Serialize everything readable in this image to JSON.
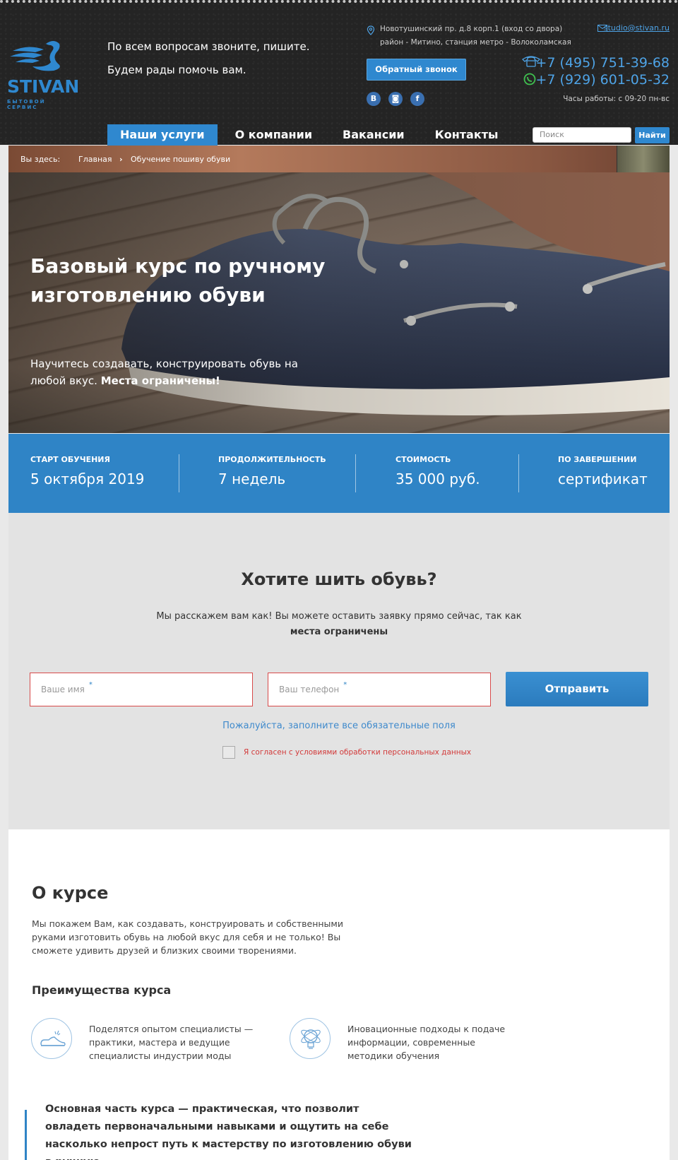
{
  "header": {
    "logo_text": "STIVAN",
    "logo_sub": "БЫТОВОЙ СЕРВИС",
    "tagline_line1": "По всем вопросам звоните, пишите.",
    "tagline_line2": "Будем рады помочь вам.",
    "address_line1": "Новотушинский пр. д.8 корп.1 (вход со двора)",
    "address_line2": "район - Митино, станция метро - Волоколамская",
    "callback_label": "Обратный звонок",
    "socials": [
      "В",
      "◙",
      "f"
    ],
    "email": "studio@stivan.ru",
    "phone1": "+7 (495) 751-39-68",
    "phone2": "+7 (929) 601-05-32",
    "hours": "Часы работы: с 09-20 пн-вс",
    "accent_color": "#2f88cf"
  },
  "nav": {
    "items": [
      {
        "label": "Наши услуги",
        "active": true
      },
      {
        "label": "О компании",
        "active": false
      },
      {
        "label": "Вакансии",
        "active": false
      },
      {
        "label": "Контакты",
        "active": false
      }
    ],
    "search_placeholder": "Поиск",
    "search_button": "Найти"
  },
  "breadcrumb": {
    "prefix": "Вы здесь:",
    "home": "Главная",
    "separator": "›",
    "current": "Обучение пошиву обуви"
  },
  "hero": {
    "title": "Базовый курс по ручному изготовлению обуви",
    "subtitle": "Научитесь создавать, конструировать обувь на любой вкус.",
    "subtitle_bold": "Места ограничены!"
  },
  "stats": [
    {
      "label": "СТАРТ ОБУЧЕНИЯ",
      "value": "5 октября 2019"
    },
    {
      "label": "ПРОДОЛЖИТЕЛЬНОСТЬ",
      "value": "7 недель"
    },
    {
      "label": "СТОИМОСТЬ",
      "value": "35 000 руб."
    },
    {
      "label": "ПО ЗАВЕРШЕНИИ",
      "value": "сертификат"
    }
  ],
  "form": {
    "title": "Хотите шить обувь?",
    "text": "Мы расскажем вам как! Вы можете оставить заявку прямо сейчас, так как",
    "text_bold": "места ограничены",
    "name_placeholder": "Ваше имя",
    "phone_placeholder": "Ваш телефон",
    "required_mark": "*",
    "submit_label": "Отправить",
    "warning": "Пожалуйста, заполните все обязательные поля",
    "consent": "Я согласен с условиями обработки персональных данных"
  },
  "about": {
    "title": "О курсе",
    "text": "Мы покажем Вам, как создавать, конструировать и собственными руками изготовить обувь на любой вкус для себя и не только! Вы сможете удивить друзей и близких своими творениями.",
    "advantages_title": "Преимущества курса",
    "advantages": [
      {
        "icon": "shoe-icon",
        "text": "Поделятся опытом специалисты — практики, мастера и ведущие специалисты индустрии моды"
      },
      {
        "icon": "lightbulb-icon",
        "text": "Иновационные подходы к подаче информации, современные методики обучения"
      }
    ],
    "quote": "Основная часть курса — практическая, что позволит овладеть первоначальными навыками и ощутить на себе насколько непрост путь к мастерству по изготовлению обуви в ручную."
  }
}
